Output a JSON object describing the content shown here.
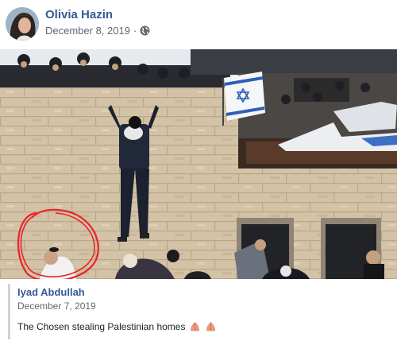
{
  "post": {
    "author": "Olivia Hazin",
    "date": "December 8, 2019",
    "separator": "·",
    "privacy_icon": "globe-icon"
  },
  "photo": {
    "annotation_color": "#e8242b",
    "flag_symbol": "✡"
  },
  "shared_post": {
    "author": "Iyad Abdullah",
    "date": "December 7, 2019",
    "text": "The Chosen stealing Palestinian homes",
    "emoji_icon": "praying-hands-icon"
  },
  "colors": {
    "link": "#385898",
    "meta": "#606770",
    "text": "#1c1e21"
  }
}
